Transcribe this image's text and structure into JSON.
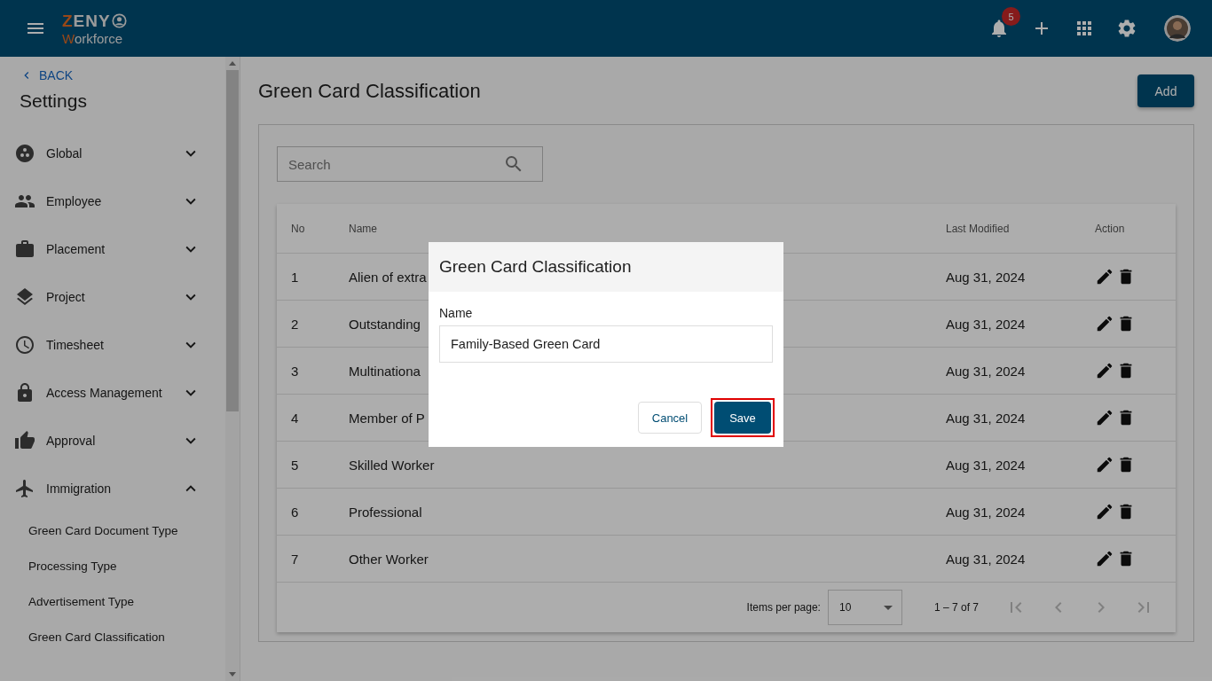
{
  "topbar": {
    "logo_top": "ZENY",
    "logo_bottom": "Workforce",
    "notification_count": "5"
  },
  "sidebar": {
    "back": "BACK",
    "title": "Settings",
    "items": [
      {
        "label": "Global",
        "expanded": false
      },
      {
        "label": "Employee",
        "expanded": false
      },
      {
        "label": "Placement",
        "expanded": false
      },
      {
        "label": "Project",
        "expanded": false
      },
      {
        "label": "Timesheet",
        "expanded": false
      },
      {
        "label": "Access Management",
        "expanded": false
      },
      {
        "label": "Approval",
        "expanded": false
      },
      {
        "label": "Immigration",
        "expanded": true,
        "children": [
          {
            "label": "Green Card Document Type"
          },
          {
            "label": "Processing Type"
          },
          {
            "label": "Advertisement Type"
          },
          {
            "label": "Green Card Classification"
          }
        ]
      }
    ]
  },
  "page": {
    "title": "Green Card Classification",
    "add_button": "Add",
    "search": {
      "placeholder": "Search"
    },
    "table": {
      "columns": [
        "No",
        "Name",
        "Last Modified",
        "Action"
      ],
      "rows": [
        {
          "no": "1",
          "name": "Alien of extra",
          "modified": "Aug 31, 2024"
        },
        {
          "no": "2",
          "name": "Outstanding",
          "modified": "Aug 31, 2024"
        },
        {
          "no": "3",
          "name": "Multinationa",
          "modified": "Aug 31, 2024"
        },
        {
          "no": "4",
          "name": "Member of P",
          "modified": "Aug 31, 2024"
        },
        {
          "no": "5",
          "name": "Skilled Worker",
          "modified": "Aug 31, 2024"
        },
        {
          "no": "6",
          "name": "Professional",
          "modified": "Aug 31, 2024"
        },
        {
          "no": "7",
          "name": "Other Worker",
          "modified": "Aug 31, 2024"
        }
      ]
    },
    "paginator": {
      "label": "Items per page:",
      "page_size": "10",
      "range": "1 – 7 of 7",
      "first_disabled": true,
      "prev_disabled": true,
      "next_disabled": true,
      "last_disabled": true
    }
  },
  "dialog": {
    "title": "Green Card Classification",
    "field_label": "Name",
    "field_value": "Family-Based Green Card",
    "cancel": "Cancel",
    "save": "Save",
    "save_highlighted": true
  }
}
